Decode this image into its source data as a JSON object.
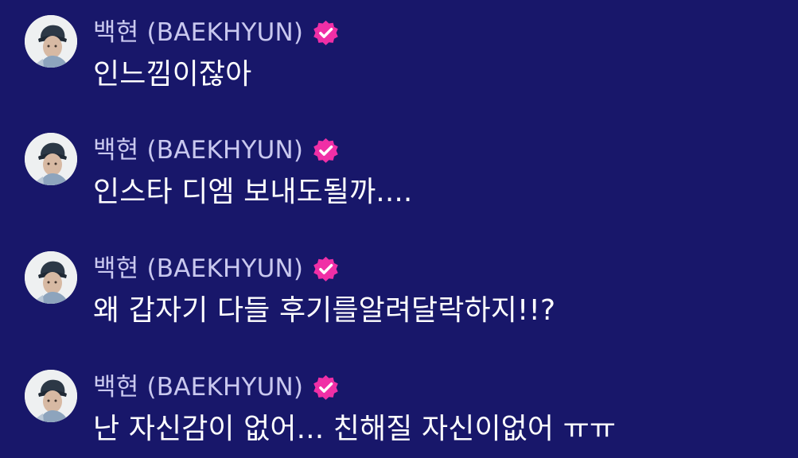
{
  "theme": {
    "background": "#18176a",
    "author_color": "#c9c8ef",
    "text_color": "#ffffff",
    "verified_color": "#f02fa6"
  },
  "messages": [
    {
      "author": "백현 (BAEKHYUN)",
      "verified_icon": "verified-badge-icon",
      "text": "인느낌이잖아"
    },
    {
      "author": "백현 (BAEKHYUN)",
      "verified_icon": "verified-badge-icon",
      "text": "인스타 디엠 보내도될까...."
    },
    {
      "author": "백현 (BAEKHYUN)",
      "verified_icon": "verified-badge-icon",
      "text": "왜 갑자기 다들 후기를알려달락하지!!?"
    },
    {
      "author": "백현 (BAEKHYUN)",
      "verified_icon": "verified-badge-icon",
      "text": "난 자신감이 없어... 친해질 자신이없어 ㅠㅠ"
    }
  ]
}
